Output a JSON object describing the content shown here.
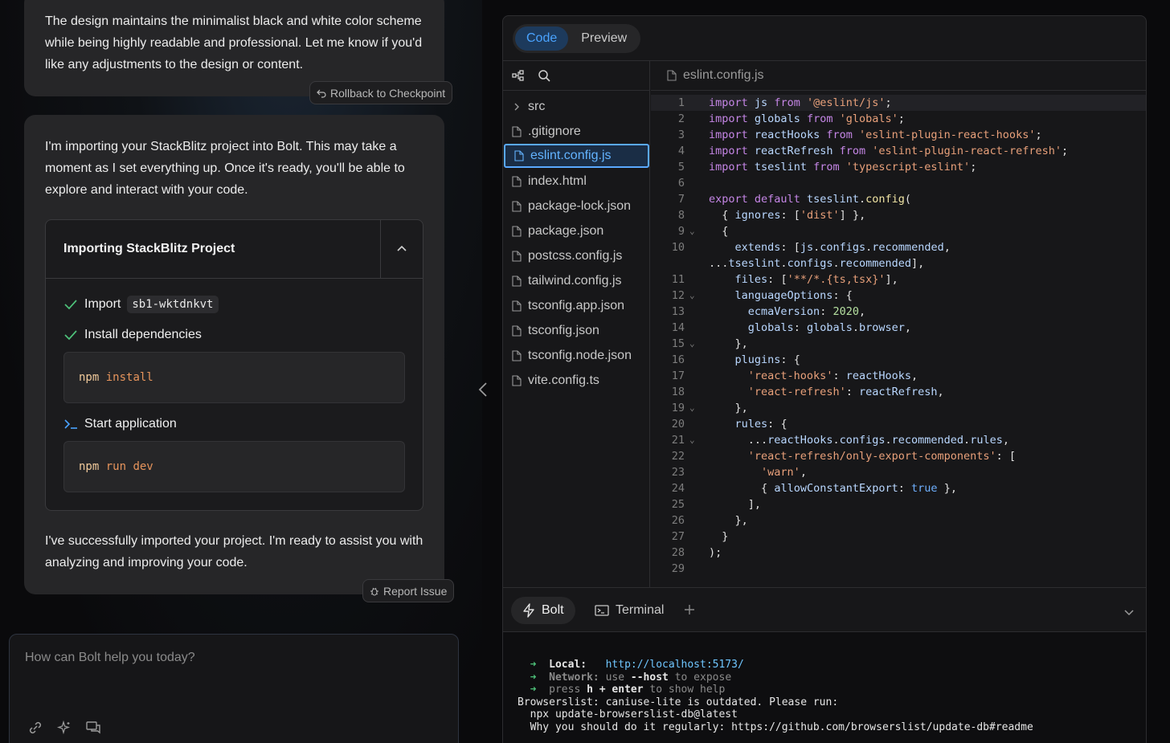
{
  "chat": {
    "message1": "The design maintains the minimalist black and white color scheme while being highly readable and professional. Let me know if you'd like any adjustments to the design or content.",
    "rollback_label": "Rollback to Checkpoint",
    "message2_intro": "I'm importing your StackBlitz project into Bolt. This may take a moment as I set everything up. Once it's ready, you'll be able to explore and interact with your code.",
    "import_box": {
      "title": "Importing StackBlitz Project",
      "step1_label": "Import",
      "step1_code": "sb1-wktdnkvt",
      "step2_label": "Install dependencies",
      "step2_cmd_a": "npm",
      "step2_cmd_b": "install",
      "step3_label": "Start application",
      "step3_cmd_a": "npm",
      "step3_cmd_b": "run dev"
    },
    "message2_outro": "I've successfully imported your project. I'm ready to assist you with analyzing and improving your code.",
    "report_label": "Report Issue",
    "prompt_placeholder": "How can Bolt help you today?"
  },
  "workbench": {
    "tabs": {
      "code": "Code",
      "preview": "Preview"
    },
    "active_file": "eslint.config.js",
    "files": [
      {
        "name": "src",
        "type": "folder"
      },
      {
        "name": ".gitignore",
        "type": "file"
      },
      {
        "name": "eslint.config.js",
        "type": "file",
        "selected": true
      },
      {
        "name": "index.html",
        "type": "file"
      },
      {
        "name": "package-lock.json",
        "type": "file"
      },
      {
        "name": "package.json",
        "type": "file"
      },
      {
        "name": "postcss.config.js",
        "type": "file"
      },
      {
        "name": "tailwind.config.js",
        "type": "file"
      },
      {
        "name": "tsconfig.app.json",
        "type": "file"
      },
      {
        "name": "tsconfig.json",
        "type": "file"
      },
      {
        "name": "tsconfig.node.json",
        "type": "file"
      },
      {
        "name": "vite.config.ts",
        "type": "file"
      }
    ],
    "code_lines": [
      "import js from '@eslint/js';",
      "import globals from 'globals';",
      "import reactHooks from 'eslint-plugin-react-hooks';",
      "import reactRefresh from 'eslint-plugin-react-refresh';",
      "import tseslint from 'typescript-eslint';",
      "",
      "export default tseslint.config(",
      "  { ignores: ['dist'] },",
      "  {",
      "    extends: [js.configs.recommended,",
      "...tseslint.configs.recommended],",
      "    files: ['**/*.{ts,tsx}'],",
      "    languageOptions: {",
      "      ecmaVersion: 2020,",
      "      globals: globals.browser,",
      "    },",
      "    plugins: {",
      "      'react-hooks': reactHooks,",
      "      'react-refresh': reactRefresh,",
      "    },",
      "    rules: {",
      "      ...reactHooks.configs.recommended.rules,",
      "      'react-refresh/only-export-components': [",
      "        'warn',",
      "        { allowConstantExport: true },",
      "      ],",
      "    },",
      "  }",
      ");",
      ""
    ],
    "line_numbers": [
      "1",
      "2",
      "3",
      "4",
      "5",
      "6",
      "7",
      "8",
      "9",
      "10",
      "",
      "11",
      "12",
      "13",
      "14",
      "15",
      "16",
      "17",
      "18",
      "19",
      "20",
      "21",
      "22",
      "23",
      "24",
      "25",
      "26",
      "27",
      "28",
      "29"
    ],
    "fold_lines": [
      8,
      12,
      15,
      19,
      21
    ],
    "terminal_tabs": {
      "bolt": "Bolt",
      "terminal": "Terminal"
    },
    "terminal": {
      "local_label": "Local:",
      "local_url": "http://localhost:5173/",
      "network_label": "Network:",
      "network_text_a": "use ",
      "network_flag": "--host",
      "network_text_b": " to expose",
      "help_text_a": "press ",
      "help_key": "h + enter",
      "help_text_b": " to show help",
      "line4": "Browserslist: caniuse-lite is outdated. Please run:",
      "line5": "  npx update-browserslist-db@latest",
      "line6": "  Why you should do it regularly: https://github.com/browserslist/update-db#readme"
    }
  },
  "colors": {
    "accent": "#4aa3ff",
    "check": "#4ec27a",
    "panel": "#262628"
  }
}
